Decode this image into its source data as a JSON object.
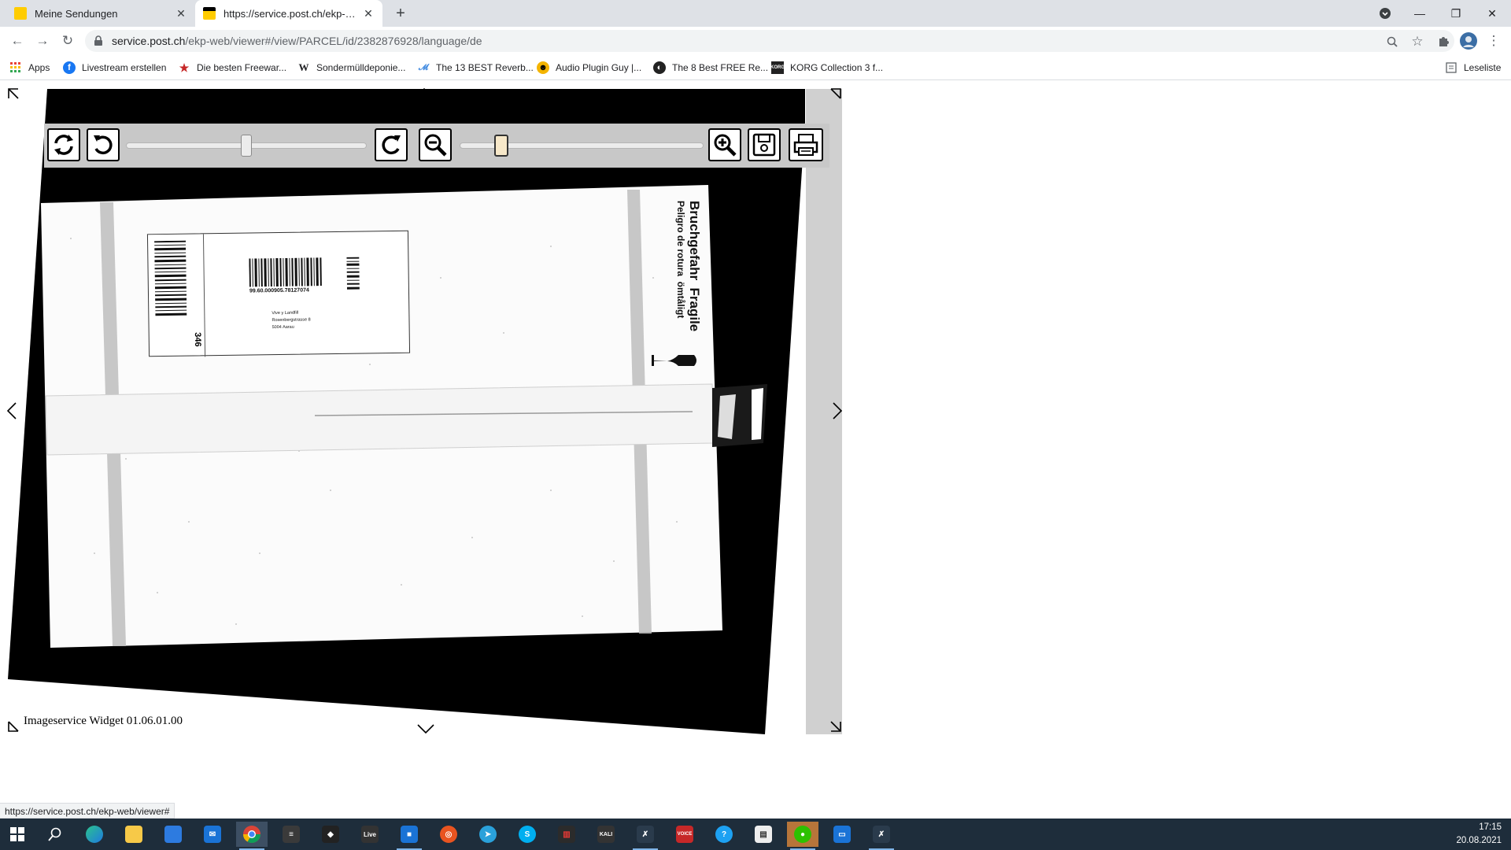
{
  "browser": {
    "tabs": [
      {
        "label": "Meine Sendungen",
        "active": false
      },
      {
        "label": "https://service.post.ch/ekp-web/viewer#",
        "active": true
      }
    ],
    "url_host": "service.post.ch",
    "url_path": "/ekp-web/viewer#/view/PARCEL/id/2382876928/language/de",
    "bookmarks": [
      {
        "label": "Apps"
      },
      {
        "label": "Livestream erstellen"
      },
      {
        "label": "Die besten Freewar..."
      },
      {
        "label": "Sondermülldeponie..."
      },
      {
        "label": "The 13 BEST Reverb..."
      },
      {
        "label": "Audio Plugin Guy |..."
      },
      {
        "label": "The 8 Best FREE Re..."
      },
      {
        "label": "KORG Collection 3 f..."
      }
    ],
    "reading_list": "Leseliste"
  },
  "viewer": {
    "widget_label": "Imageservice Widget 01.06.01.00",
    "rotation_slider": 0.5,
    "zoom_slider": 0.17,
    "parcel_label": {
      "tracking": "99.60.000905.78127074",
      "recipient_lines": [
        "Vive y Landfill",
        "Rosenbergstrasse 8",
        "5004 Aarau"
      ],
      "code": "346"
    },
    "fragile_text_1": "Bruchgefahr  Fragile",
    "fragile_text_2": "Peligro de rotura  ömtåligt"
  },
  "status_url": "https://service.post.ch/ekp-web/viewer#",
  "taskbar": {
    "live_label": "Live",
    "kali_label": "KALI",
    "voice_label": "VOICE",
    "time": "17:15",
    "date": "20.08.2021"
  },
  "colors": {
    "tabstrip": "#dee1e6",
    "taskbar": "#1e2d3b",
    "viewer_toolbar": "#c8c8c8"
  }
}
